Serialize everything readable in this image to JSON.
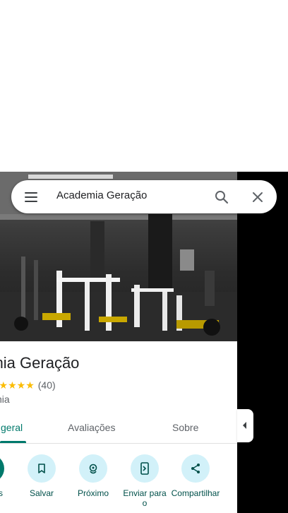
{
  "search": {
    "query": "Academia Geração"
  },
  "place": {
    "title": "demia Geração",
    "stars": "★★★★★",
    "review_count": "(40)",
    "category": "nia"
  },
  "tabs": [
    {
      "label": "geral"
    },
    {
      "label": "Avaliações"
    },
    {
      "label": "Sobre"
    }
  ],
  "actions": {
    "first_label": "s",
    "items": [
      {
        "label": "Salvar",
        "icon": "bookmark-icon"
      },
      {
        "label": "Próximo",
        "icon": "nearby-icon"
      },
      {
        "label": "Enviar para o",
        "icon": "send-to-phone-icon"
      },
      {
        "label": "Compartilhar",
        "icon": "share-icon"
      }
    ]
  },
  "colors": {
    "accent": "#00796b",
    "action_bg": "#d2f1f9",
    "star": "#fbbc04"
  }
}
